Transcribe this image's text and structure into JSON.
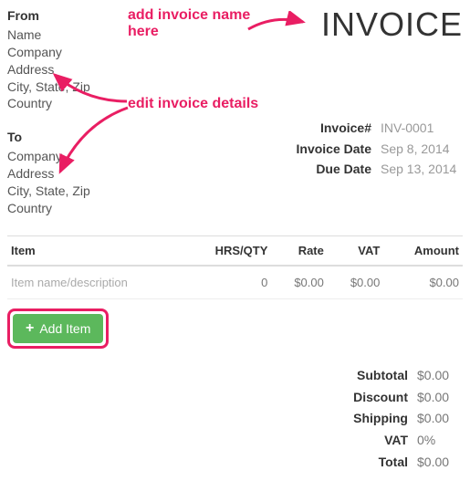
{
  "from": {
    "label": "From",
    "name_value": "Name",
    "company": "Company",
    "address": "Address",
    "csz": "City, State, Zip",
    "country": "Country"
  },
  "to": {
    "label": "To",
    "company": "Company",
    "address": "Address",
    "csz": "City, State, Zip",
    "country": "Country"
  },
  "title": "INVOICE",
  "meta": {
    "invoice_no_label": "Invoice#",
    "invoice_no": "INV-0001",
    "invoice_date_label": "Invoice Date",
    "invoice_date": "Sep 8, 2014",
    "due_date_label": "Due Date",
    "due_date": "Sep 13, 2014"
  },
  "table": {
    "headers": {
      "item": "Item",
      "qty": "HRS/QTY",
      "rate": "Rate",
      "vat": "VAT",
      "amount": "Amount"
    },
    "row": {
      "desc": "Item name/description",
      "qty": "0",
      "rate": "$0.00",
      "vat": "$0.00",
      "amount": "$0.00"
    }
  },
  "add_item_label": "Add Item",
  "totals": {
    "subtotal_label": "Subtotal",
    "subtotal": "$0.00",
    "discount_label": "Discount",
    "discount": "$0.00",
    "shipping_label": "Shipping",
    "shipping": "$0.00",
    "vat_label": "VAT",
    "vat": "0%",
    "total_label": "Total",
    "total": "$0.00"
  },
  "annotations": {
    "a1": "add invoice name here",
    "a2": "edit invoice details"
  }
}
